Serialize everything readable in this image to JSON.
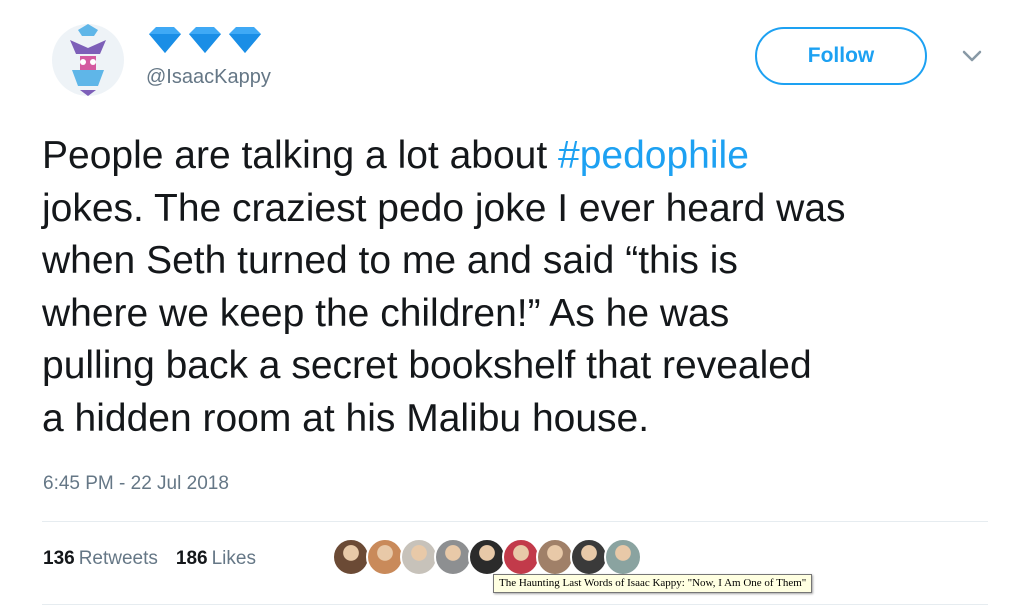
{
  "tweet": {
    "handle": "@IsaacKappy",
    "follow_label": "Follow",
    "text_lines": [
      [
        "People are talking a lot about ",
        "#pedophile"
      ],
      [
        "jokes. The craziest pedo joke I ever heard was"
      ],
      [
        "when Seth turned to me and said “this is"
      ],
      [
        "where we keep the children!” As he was"
      ],
      [
        "pulling back a secret bookshelf that revealed"
      ],
      [
        "a hidden room at his Malibu house."
      ]
    ],
    "timestamp": "6:45 PM - 22 Jul 2018",
    "retweets_count": "136",
    "retweets_label": "Retweets",
    "likes_count": "186",
    "likes_label": "Likes"
  },
  "icons": {
    "avatar": "avatar-icon",
    "badges": "diamond-icon",
    "more": "chevron-down-icon"
  },
  "colors": {
    "accent": "#1da1f2",
    "diamond": "#3fa9f5",
    "muted": "#657786",
    "text": "#14171a"
  },
  "likers": [
    {
      "name": "liker-avatar-1",
      "color": "#6b4a35"
    },
    {
      "name": "liker-avatar-2",
      "color": "#c98a5a"
    },
    {
      "name": "liker-avatar-3",
      "color": "#c7c2ba"
    },
    {
      "name": "liker-avatar-4",
      "color": "#8d8f91"
    },
    {
      "name": "liker-avatar-5",
      "color": "#2b2b2b"
    },
    {
      "name": "liker-avatar-6",
      "color": "#c23a4a"
    },
    {
      "name": "liker-avatar-7",
      "color": "#a08068"
    },
    {
      "name": "liker-avatar-8",
      "color": "#3a3a3a"
    },
    {
      "name": "liker-avatar-9",
      "color": "#8aa3a0"
    }
  ],
  "tooltip": "The Haunting Last Words of Isaac Kappy: \"Now, I Am One of Them\""
}
